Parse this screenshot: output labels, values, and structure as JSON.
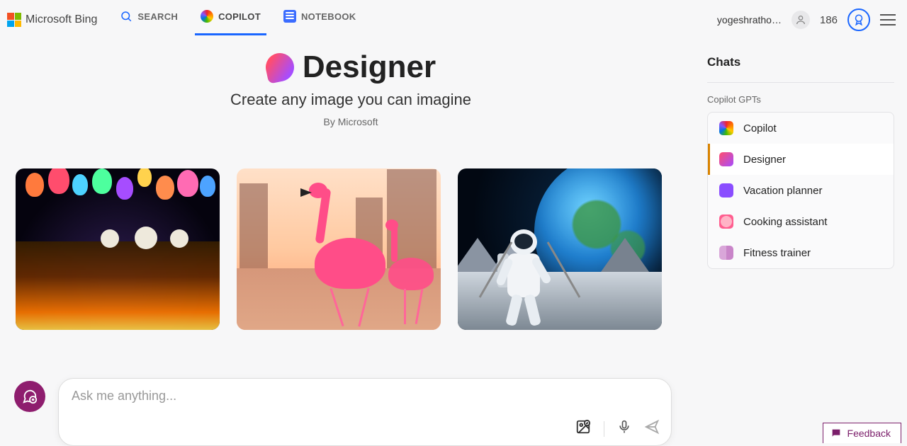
{
  "header": {
    "brand": "Microsoft Bing",
    "tabs": {
      "search": "SEARCH",
      "copilot": "COPILOT",
      "notebook": "NOTEBOOK"
    },
    "username": "yogeshratho…",
    "points": "186"
  },
  "hero": {
    "title": "Designer",
    "subtitle": "Create any image you can imagine",
    "byline": "By Microsoft"
  },
  "chat": {
    "placeholder": "Ask me anything..."
  },
  "sidebar": {
    "chats_heading": "Chats",
    "gpts_heading": "Copilot GPTs",
    "items": [
      {
        "label": "Copilot"
      },
      {
        "label": "Designer"
      },
      {
        "label": "Vacation planner"
      },
      {
        "label": "Cooking assistant"
      },
      {
        "label": "Fitness trainer"
      }
    ]
  },
  "feedback": {
    "label": "Feedback"
  }
}
